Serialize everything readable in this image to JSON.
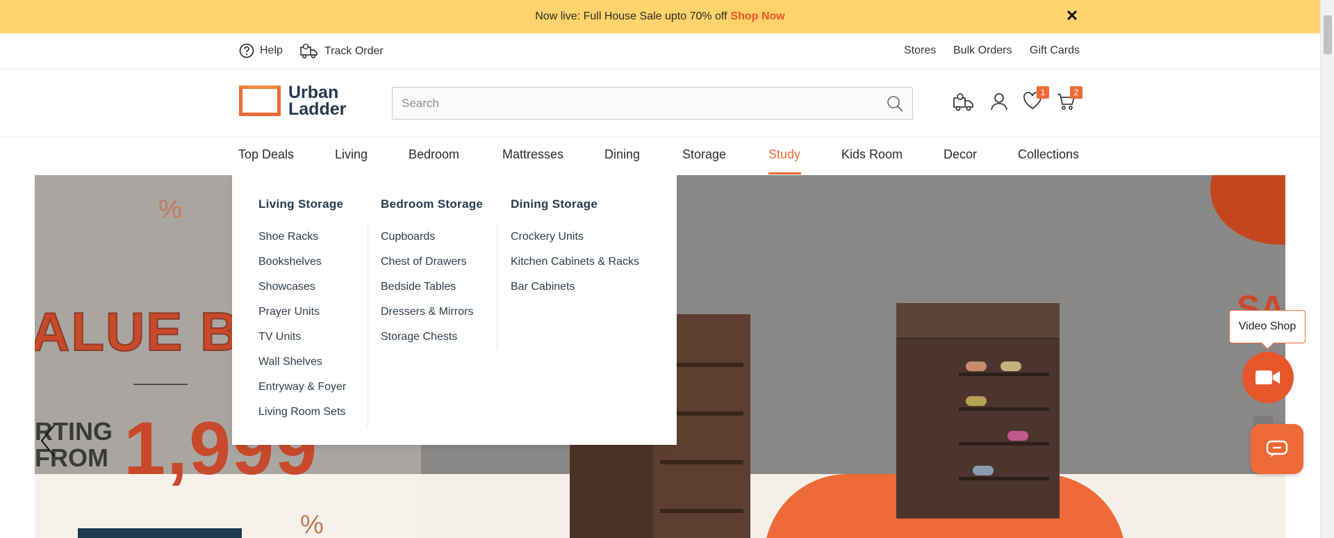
{
  "announcement": {
    "text": "Now live: Full House Sale upto 70% off",
    "link": "Shop Now",
    "close_label": "✕"
  },
  "utility": {
    "help": "Help",
    "track_order": "Track Order",
    "stores": "Stores",
    "bulk_orders": "Bulk Orders",
    "gift_cards": "Gift Cards"
  },
  "header": {
    "logo_line1": "Urban",
    "logo_line2": "Ladder",
    "search_placeholder": "Search",
    "wishlist_count": "1",
    "cart_count": "2"
  },
  "nav": {
    "items": [
      "Top Deals",
      "Living",
      "Bedroom",
      "Mattresses",
      "Dining",
      "Storage",
      "Study",
      "Kids Room",
      "Decor",
      "Collections"
    ],
    "active": "Study"
  },
  "mega_menu": {
    "columns": [
      {
        "title": "Living Storage",
        "items": [
          "Shoe Racks",
          "Bookshelves",
          "Showcases",
          "Prayer Units",
          "TV Units",
          "Wall Shelves",
          "Entryway & Foyer",
          "Living Room Sets"
        ]
      },
      {
        "title": "Bedroom Storage",
        "items": [
          "Cupboards",
          "Chest of Drawers",
          "Bedside Tables",
          "Dressers & Mirrors",
          "Storage Chests"
        ]
      },
      {
        "title": "Dining Storage",
        "items": [
          "Crockery Units",
          "Kitchen Cabinets & Racks",
          "Bar Cabinets"
        ]
      }
    ]
  },
  "hero": {
    "headline": "ALUE BU",
    "starting_line1": "RTING",
    "starting_line2": "FROM",
    "price": "1,999",
    "pct_symbol": "%",
    "pct_symbol_2": "%",
    "right_text": "SA"
  },
  "widgets": {
    "video_shop": "Video Shop"
  },
  "colors": {
    "accent": "#ee6a37",
    "announce_bg": "#ffd36b",
    "navy": "#263a4f"
  }
}
